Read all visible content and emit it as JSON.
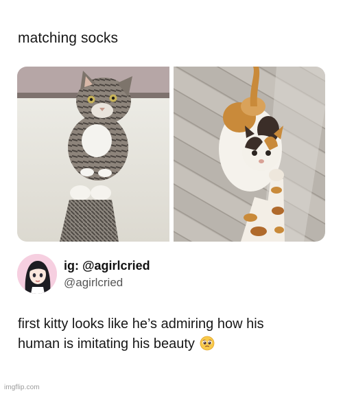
{
  "post": {
    "title": "matching socks",
    "author": {
      "display_handle": "ig: @agirlcried",
      "username": "@agirlcried"
    },
    "caption_line1": "first kitty looks like he’s admiring how his",
    "caption_line2": "human is imitating his beauty",
    "caption_emoji": "pleading-face-emoji"
  },
  "watermark": "imgflip.com",
  "colors": {
    "text": "#161616",
    "secondary_text": "#555555",
    "background": "#ffffff"
  },
  "images": [
    {
      "name": "tabby-cat-photo",
      "icon": "photo"
    },
    {
      "name": "calico-cat-photo",
      "icon": "photo"
    }
  ]
}
